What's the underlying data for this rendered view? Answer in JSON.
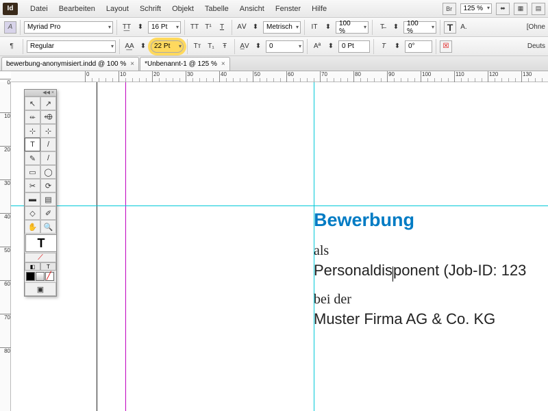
{
  "app_logo": "Id",
  "menu": [
    "Datei",
    "Bearbeiten",
    "Layout",
    "Schrift",
    "Objekt",
    "Tabelle",
    "Ansicht",
    "Fenster",
    "Hilfe"
  ],
  "menu_right_zoom": "125 %",
  "menu_right_btns": [
    "Br",
    "⬌",
    "▦",
    "▤"
  ],
  "row1": {
    "letter_A": "A",
    "font": "Myriad Pro",
    "tt_ic": "T͟T",
    "size_updown": "⬍",
    "size": "16 Pt",
    "caps_btns": [
      "TT",
      "T¹",
      "T"
    ],
    "av_ic": "AⅤ",
    "av_dd": "⬍",
    "kerning": "Metrisch",
    "it_ic": "IT",
    "it_dd": "⬍",
    "hscale": "100 %",
    "t_ic": "T̶",
    "t_dd": "⬍",
    "vscale": "100 %",
    "bigT": "T",
    "aA": "A.",
    "ohne": "[Ohne"
  },
  "row2": {
    "weight": "Regular",
    "lead_ic": "A͟A",
    "lead_dd": "⬍",
    "leading": "22 Pt",
    "sub_btns": [
      "Tᴛ",
      "T₁",
      "Ŧ"
    ],
    "track_ic": "A̲V",
    "track_dd": "⬍",
    "tracking": "0",
    "baseline_ic": "Aª",
    "baseline_dd": "⬍",
    "baseline": "0 Pt",
    "ital": "T",
    "skew_dd": "⬍",
    "skew": "0°",
    "strike": "☒",
    "lang": "Deuts"
  },
  "tabs": [
    {
      "label": "bewerbung-anonymisiert.indd @ 100 %"
    },
    {
      "label": "*Unbenannt-1 @ 125 %"
    }
  ],
  "rulerH": [
    0,
    10,
    20,
    30,
    40,
    50,
    60,
    70,
    80,
    90,
    100,
    110,
    120,
    130
  ],
  "rulerV": [
    0,
    10,
    20,
    30,
    40,
    50,
    60,
    70,
    80
  ],
  "doc": {
    "title": "Bewerbung",
    "l1": "als",
    "l2a": "Personaldis",
    "l2b": "ponent (Job-ID: 123",
    "l3": "bei der",
    "l4": "Muster Firma AG & Co. KG"
  },
  "tools": [
    [
      "↖",
      "↗"
    ],
    [
      "⬰",
      "⬲"
    ],
    [
      "⊹",
      "⊹"
    ],
    [
      "T",
      "/"
    ],
    [
      "✎",
      "/"
    ],
    [
      "▭",
      "◯"
    ],
    [
      "✂",
      "⟳"
    ],
    [
      "▬",
      "▤"
    ],
    [
      "◇",
      "✐"
    ],
    [
      "✋",
      "🔍"
    ]
  ],
  "bigT": "T",
  "tinies": [
    "◧",
    "T"
  ],
  "swatches": [
    "#000",
    "#fff",
    "#f00"
  ]
}
